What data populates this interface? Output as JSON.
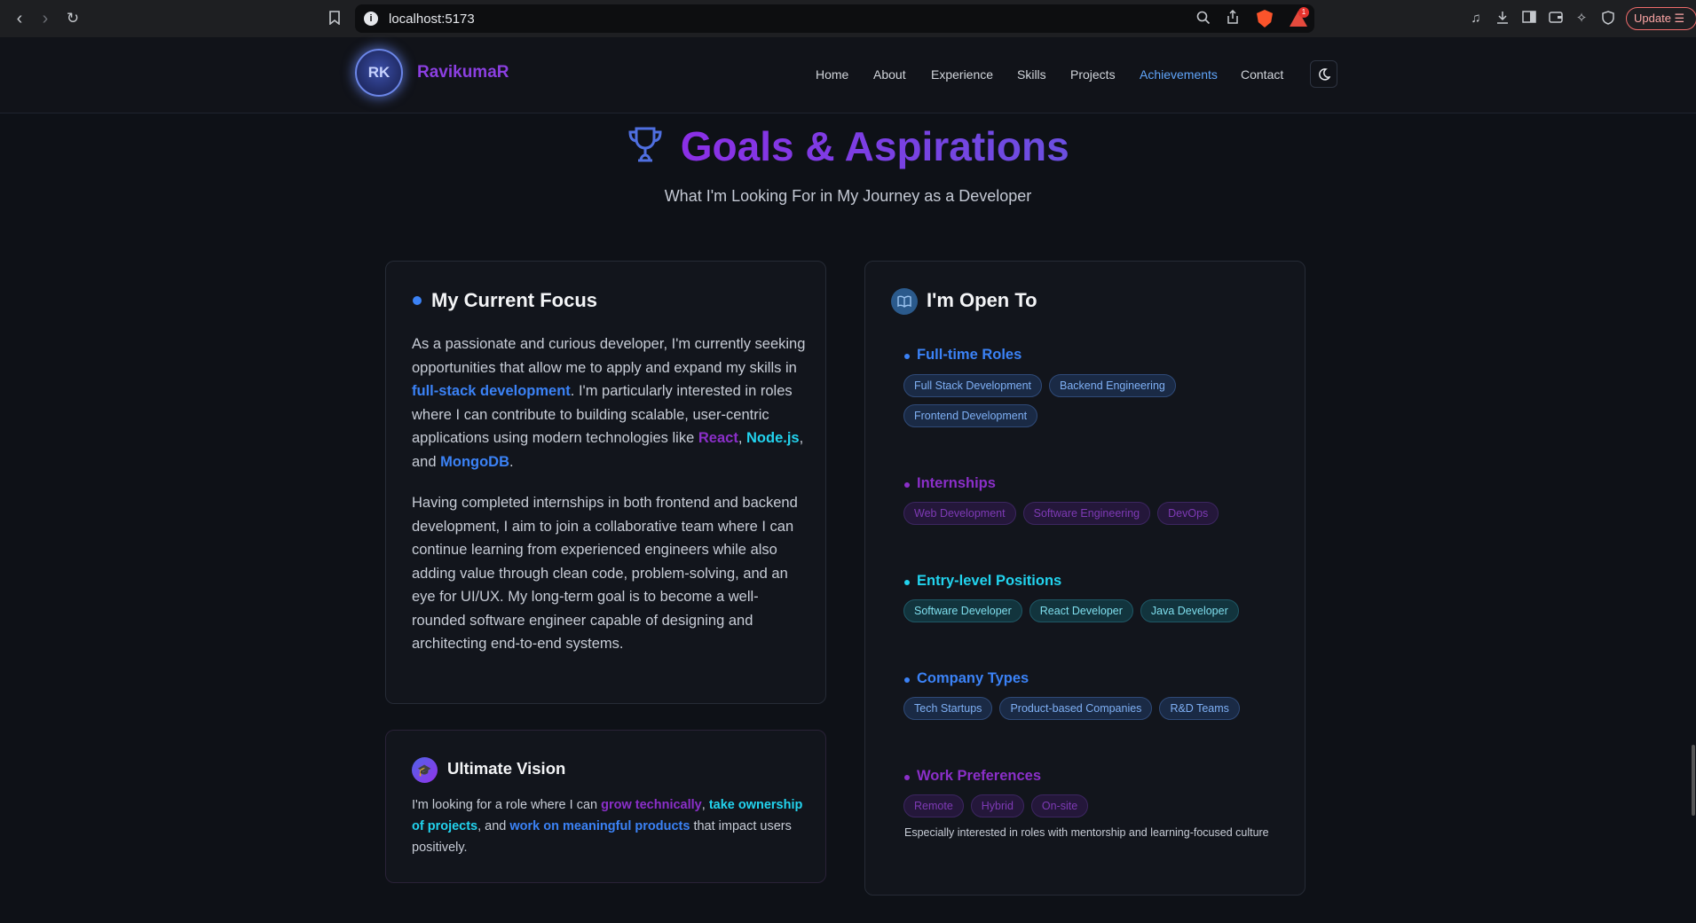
{
  "browser": {
    "url": "localhost:5173",
    "alert_count": "1",
    "update_label": "Update"
  },
  "header": {
    "logo_initials": "RK",
    "brand_name": "RavikumaR",
    "nav": [
      {
        "label": "Home",
        "active": false
      },
      {
        "label": "About",
        "active": false
      },
      {
        "label": "Experience",
        "active": false
      },
      {
        "label": "Skills",
        "active": false
      },
      {
        "label": "Projects",
        "active": false
      },
      {
        "label": "Achievements",
        "active": true
      },
      {
        "label": "Contact",
        "active": false
      }
    ],
    "theme_icon": "moon-icon"
  },
  "section": {
    "icon": "trophy-icon",
    "title": "Goals & Aspirations",
    "subtitle": "What I'm Looking For in My Journey as a Developer"
  },
  "focus": {
    "heading": "My Current Focus",
    "p1": {
      "a": "As a passionate and curious developer, I'm currently seeking opportunities that allow me to apply and expand my skills in ",
      "hl1": "full-stack development",
      "b": ". I'm particularly interested in roles where I can contribute to building scalable, user-centric applications using modern technologies like ",
      "hl2": "React",
      "c": ", ",
      "hl3": "Node.js",
      "d": ", and ",
      "hl4": "MongoDB",
      "e": "."
    },
    "p2": "Having completed internships in both frontend and backend development, I aim to join a collaborative team where I can continue learning from experienced engineers while also adding value through clean code, problem-solving, and an eye for UI/UX. My long-term goal is to become a well-rounded software engineer capable of designing and architecting end-to-end systems."
  },
  "vision": {
    "icon": "graduation-cap-icon",
    "heading": "Ultimate Vision",
    "a": "I'm looking for a role where I can ",
    "hl1": "grow technically",
    "b": ", ",
    "hl2": "take ownership of projects",
    "c": ", and ",
    "hl3": "work on meaningful products",
    "d": " that impact users positively."
  },
  "open": {
    "icon": "book-icon",
    "heading": "I'm Open To",
    "groups": [
      {
        "title": "Full-time Roles",
        "color": "#3b82f6",
        "tags": [
          "Full Stack Development",
          "Backend Engineering",
          "Frontend Development"
        ]
      },
      {
        "title": "Internships",
        "color": "#8b2fc9",
        "tags": [
          "Web Development",
          "Software Engineering",
          "DevOps"
        ]
      },
      {
        "title": "Entry-level Positions",
        "color": "#22d3ee",
        "tags": [
          "Software Developer",
          "React Developer",
          "Java Developer"
        ]
      },
      {
        "title": "Company Types",
        "color": "#3b82f6",
        "tags": [
          "Tech Startups",
          "Product-based Companies",
          "R&D Teams"
        ]
      },
      {
        "title": "Work Preferences",
        "color": "#8b2fc9",
        "tags": [
          "Remote",
          "Hybrid",
          "On-site"
        ]
      }
    ],
    "note": "Especially interested in roles with mentorship and learning-focused culture"
  },
  "colors": {
    "background": "#0e1117",
    "accent_purple": "#8b2fc9",
    "accent_blue": "#3b82f6",
    "accent_cyan": "#22d3ee"
  }
}
